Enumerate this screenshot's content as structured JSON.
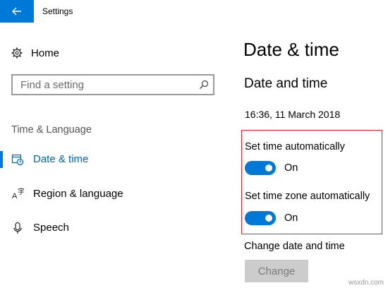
{
  "window": {
    "title": "Settings"
  },
  "sidebar": {
    "home_label": "Home",
    "search_placeholder": "Find a setting",
    "section_label": "Time & Language",
    "items": [
      {
        "label": "Date & time",
        "icon": "calendar-clock-icon",
        "selected": true
      },
      {
        "label": "Region & language",
        "icon": "language-icon",
        "selected": false
      },
      {
        "label": "Speech",
        "icon": "microphone-icon",
        "selected": false
      }
    ]
  },
  "main": {
    "title": "Date & time",
    "subheading": "Date and time",
    "current_datetime": "16:36, 11 March 2018",
    "set_time_auto": {
      "label": "Set time automatically",
      "state": "On",
      "on": true
    },
    "set_timezone_auto": {
      "label": "Set time zone automatically",
      "state": "On",
      "on": true
    },
    "change_section_label": "Change date and time",
    "change_button": "Change"
  },
  "watermark": "wsxdn.com",
  "colors": {
    "accent": "#0078d7",
    "highlight_border": "#d9252a",
    "disabled_button": "#cccccc"
  }
}
